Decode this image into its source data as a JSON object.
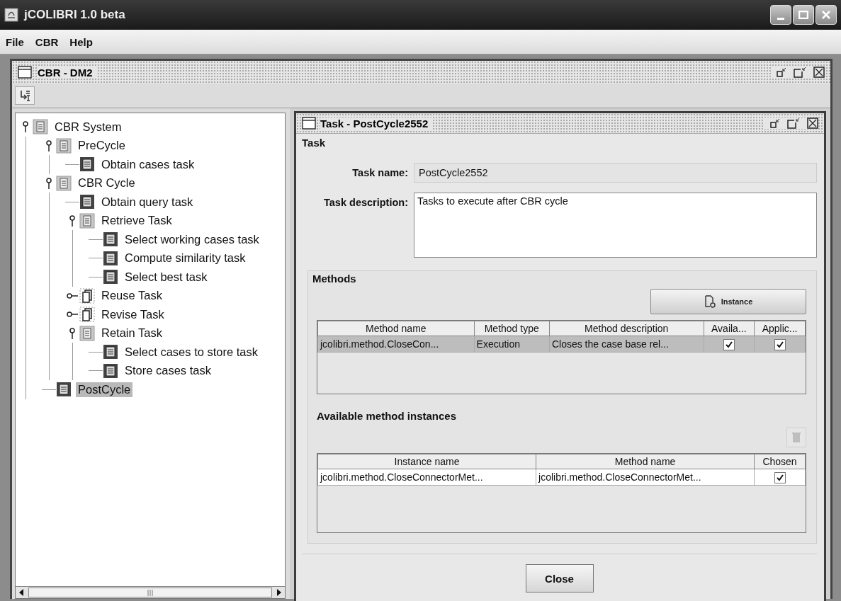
{
  "window": {
    "title": "jCOLIBRI 1.0 beta"
  },
  "menu": [
    "File",
    "CBR",
    "Help"
  ],
  "frame": {
    "title": "CBR - DM2"
  },
  "tree": [
    {
      "label": "CBR System",
      "kind": "group",
      "expanded": true,
      "selected": false,
      "children": [
        {
          "label": "PreCycle",
          "kind": "group",
          "expanded": true,
          "selected": false,
          "children": [
            {
              "label": "Obtain cases task",
              "kind": "task",
              "selected": false
            }
          ]
        },
        {
          "label": "CBR Cycle",
          "kind": "group",
          "expanded": true,
          "selected": false,
          "children": [
            {
              "label": "Obtain query task",
              "kind": "task",
              "selected": false
            },
            {
              "label": "Retrieve Task",
              "kind": "group",
              "expanded": true,
              "selected": false,
              "children": [
                {
                  "label": "Select working cases task",
                  "kind": "task",
                  "selected": false
                },
                {
                  "label": "Compute similarity task",
                  "kind": "task",
                  "selected": false
                },
                {
                  "label": "Select best task",
                  "kind": "task",
                  "selected": false
                }
              ]
            },
            {
              "label": "Reuse Task",
              "kind": "pending",
              "expanded": false,
              "selected": false
            },
            {
              "label": "Revise Task",
              "kind": "pending",
              "expanded": false,
              "selected": false
            },
            {
              "label": "Retain Task",
              "kind": "group",
              "expanded": true,
              "selected": false,
              "children": [
                {
                  "label": "Select cases to store task",
                  "kind": "task",
                  "selected": false
                },
                {
                  "label": "Store cases task",
                  "kind": "task",
                  "selected": false
                }
              ]
            }
          ]
        },
        {
          "label": "PostCycle",
          "kind": "task",
          "selected": true
        }
      ]
    }
  ],
  "dialog": {
    "title": "Task - PostCycle2552",
    "section": "Task",
    "name_label": "Task name:",
    "name_value": "PostCycle2552",
    "description_label": "Task description:",
    "description_value": "Tasks to execute after CBR cycle",
    "methods": {
      "title": "Methods",
      "instance_button": "Instance",
      "columns": [
        "Method name",
        "Method type",
        "Method description",
        "Availa...",
        "Applic..."
      ],
      "rows": [
        {
          "cells": [
            "jcolibri.method.CloseCon...",
            "Execution",
            "Closes the case base rel..."
          ],
          "available": true,
          "applicable": true,
          "selected": true
        }
      ]
    },
    "instances": {
      "title": "Available method instances",
      "delete_disabled": true,
      "columns": [
        "Instance name",
        "Method name",
        "Chosen"
      ],
      "rows": [
        {
          "cells": [
            "jcolibri.method.CloseConnectorMet...",
            "jcolibri.method.CloseConnectorMet..."
          ],
          "chosen": true,
          "selected": false
        }
      ]
    },
    "close_button": "Close"
  }
}
